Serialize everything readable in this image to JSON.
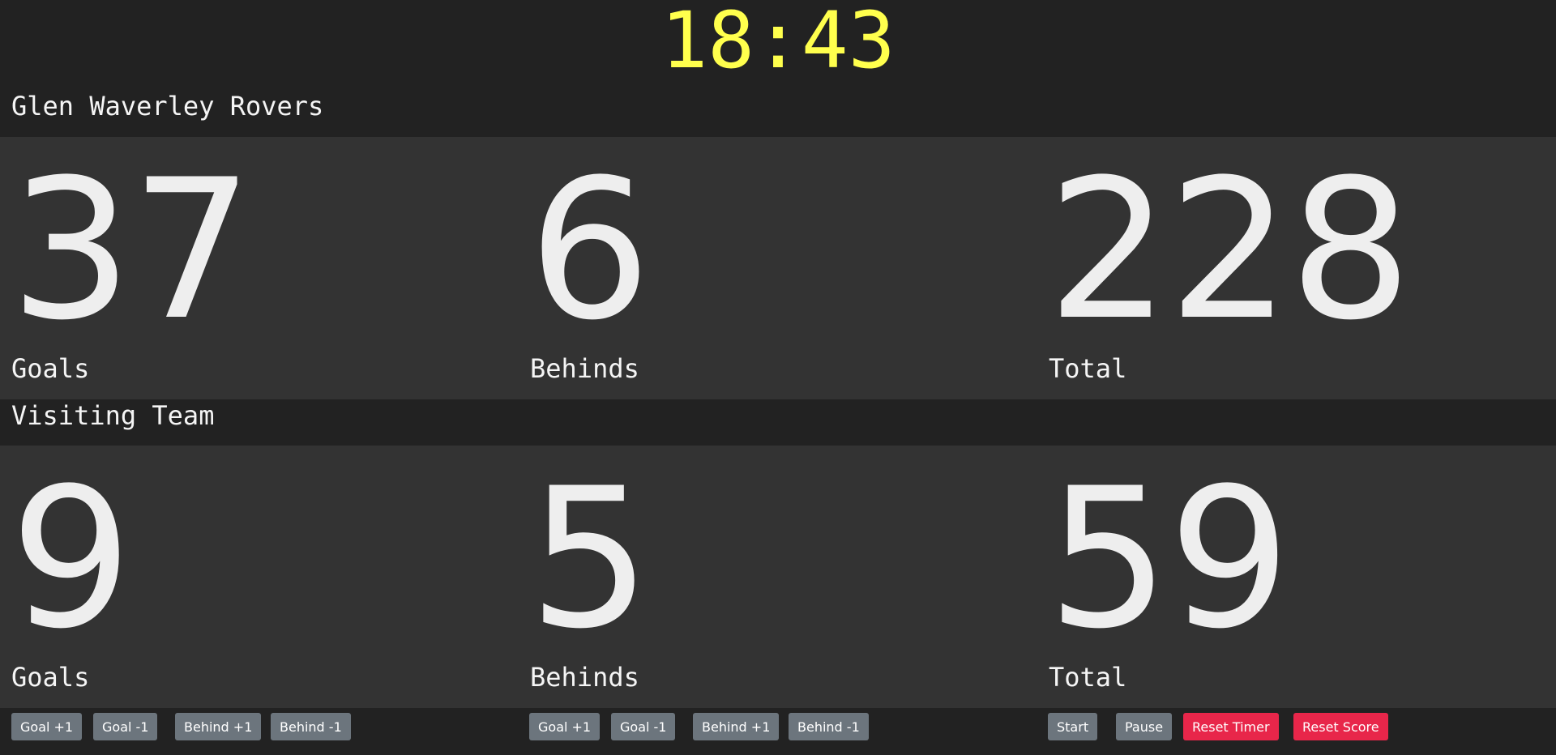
{
  "timer": {
    "display": "18:43"
  },
  "home": {
    "name": "Glen Waverley Rovers",
    "goals": "37",
    "behinds": "6",
    "total": "228",
    "labels": {
      "goals": "Goals",
      "behinds": "Behinds",
      "total": "Total"
    }
  },
  "away": {
    "name": "Visiting Team",
    "goals": "9",
    "behinds": "5",
    "total": "59",
    "labels": {
      "goals": "Goals",
      "behinds": "Behinds",
      "total": "Total"
    }
  },
  "home_controls": {
    "goal_plus": "Goal +1",
    "goal_minus": "Goal -1",
    "behind_plus": "Behind +1",
    "behind_minus": "Behind -1"
  },
  "away_controls": {
    "goal_plus": "Goal +1",
    "goal_minus": "Goal -1",
    "behind_plus": "Behind +1",
    "behind_minus": "Behind -1"
  },
  "game_controls": {
    "start": "Start",
    "pause": "Pause",
    "reset_timer": "Reset Timer",
    "reset_score": "Reset Score"
  },
  "colors": {
    "background": "#222222",
    "panel": "#333333",
    "clock": "#ffff4d",
    "button": "#6c757d",
    "danger": "#e8264a"
  }
}
